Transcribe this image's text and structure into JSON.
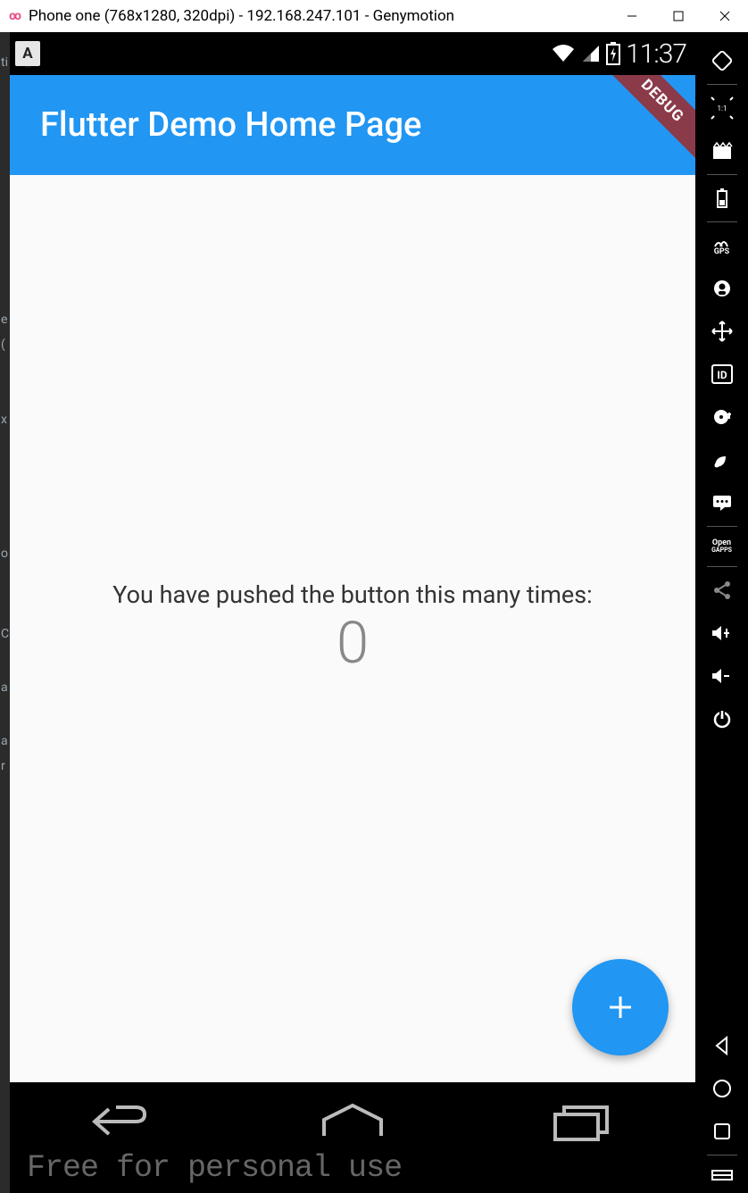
{
  "window": {
    "title": "Phone one (768x1280, 320dpi) - 192.168.247.101 - Genymotion"
  },
  "status_bar": {
    "keyboard_indicator": "A",
    "time": "11:37"
  },
  "app_bar": {
    "title": "Flutter Demo Home Page",
    "debug_ribbon": "DEBUG"
  },
  "body": {
    "message": "You have pushed the button this many times:",
    "count": "0"
  },
  "watermark": "Free for personal use",
  "sidebar": {
    "open_gapps_line1": "Open",
    "open_gapps_line2": "GAPPS",
    "gps_label": "GPS"
  },
  "ide_fragments": {
    "f1": "ti",
    "f2": "e",
    "f3": "(",
    "f4": "x",
    "f5": "o",
    "f6": "C",
    "f7": "a",
    "f8": "a",
    "f9": "r"
  }
}
